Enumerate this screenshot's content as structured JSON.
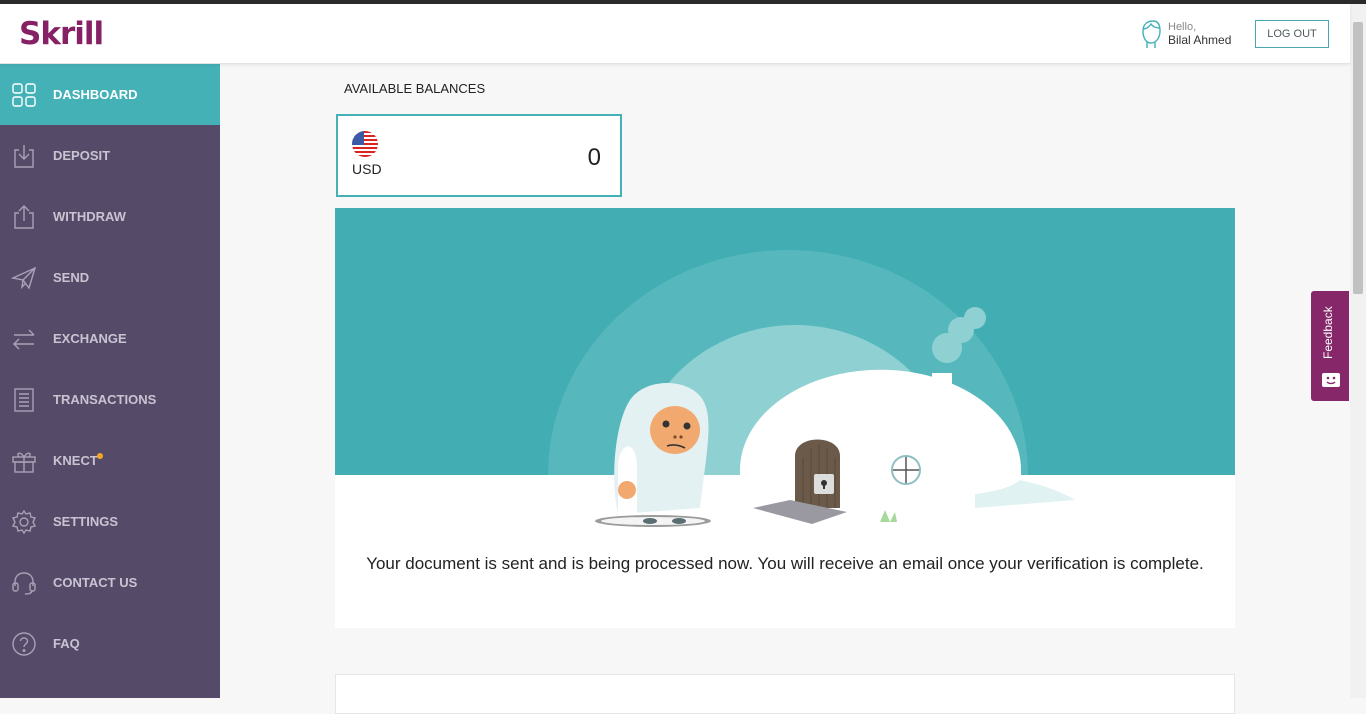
{
  "app": {
    "brand": "Skrill",
    "brand_color": "#862165",
    "accent": "#43b1b6"
  },
  "header": {
    "greeting": "Hello,",
    "user_name": "Bilal Ahmed",
    "logout_label": "LOG OUT"
  },
  "sidebar": {
    "items": [
      {
        "label": "DASHBOARD",
        "icon": "dashboard-grid-icon",
        "active": true
      },
      {
        "label": "DEPOSIT",
        "icon": "deposit-icon"
      },
      {
        "label": "WITHDRAW",
        "icon": "withdraw-icon"
      },
      {
        "label": "SEND",
        "icon": "paper-plane-icon"
      },
      {
        "label": "EXCHANGE",
        "icon": "exchange-arrows-icon"
      },
      {
        "label": "TRANSACTIONS",
        "icon": "transactions-icon"
      },
      {
        "label": "KNECT",
        "icon": "gift-icon",
        "badge": true
      },
      {
        "label": "SETTINGS",
        "icon": "gear-icon"
      },
      {
        "label": "CONTACT US",
        "icon": "headset-icon"
      },
      {
        "label": "FAQ",
        "icon": "question-icon"
      }
    ]
  },
  "balances": {
    "title": "AVAILABLE BALANCES",
    "currency": "USD",
    "amount": "0",
    "flag_icon": "us-flag-icon"
  },
  "hero": {
    "message": "Your document is sent and is being processed now. You will receive an email once your verification is complete."
  },
  "feedback": {
    "label": "Feedback"
  }
}
